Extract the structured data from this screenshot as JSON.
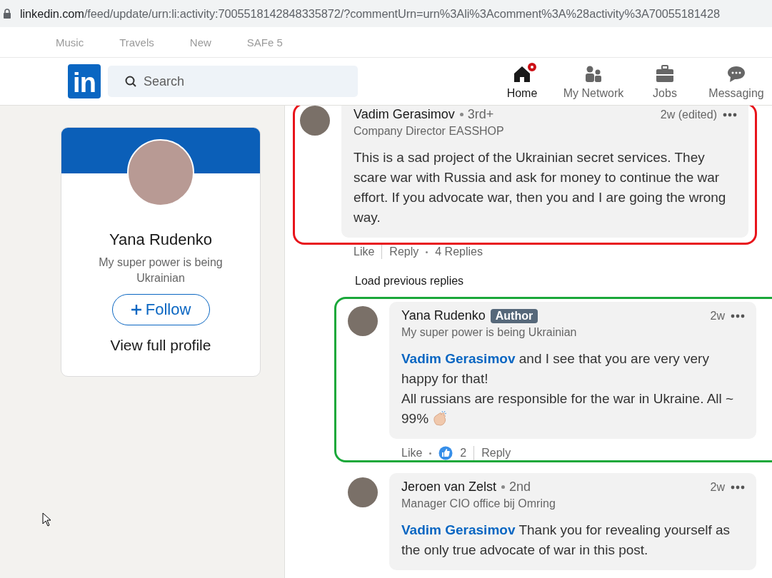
{
  "address_bar": {
    "host": "linkedin.com",
    "path": "/feed/update/urn:li:activity:7005518142848335872/?commentUrn=urn%3Ali%3Acomment%3A%28activity%3A70055181428"
  },
  "bookmarks": [
    "Music",
    "Travels",
    "New",
    "SAFe 5"
  ],
  "header": {
    "logo": "in",
    "search_placeholder": "Search",
    "nav": [
      {
        "kind": "home",
        "label": "Home",
        "selected": true,
        "notification": true
      },
      {
        "kind": "network",
        "label": "My Network",
        "selected": false,
        "notification": false
      },
      {
        "kind": "jobs",
        "label": "Jobs",
        "selected": false,
        "notification": false
      },
      {
        "kind": "messaging",
        "label": "Messaging",
        "selected": false,
        "notification": false
      }
    ]
  },
  "profile_card": {
    "name": "Yana Rudenko",
    "headline": "My super power is being Ukrainian",
    "follow_button": "Follow",
    "view_profile": "View full profile"
  },
  "comment": {
    "name": "Vadim Gerasimov",
    "degree": "3rd+",
    "headline": "Company Director EASSHOP",
    "time": "2w (edited)",
    "body": "This is a sad project of the Ukrainian secret services. They scare war with Russia and ask for money to continue the war effort. If you advocate war, then you and I are going the wrong way.",
    "like": "Like",
    "reply": "Reply",
    "replies_count": "4 Replies",
    "color": "#e8141b",
    "load_previous": "Load previous replies",
    "replies": [
      {
        "name": "Yana Rudenko",
        "badge": "Author",
        "headline": "My super power is being Ukrainian",
        "time": "2w",
        "mention": "Vadim Gerasimov",
        "body": "and I see that you are very very happy for that!\nAll russians are responsible for the war in Ukraine. All ~ 99%",
        "clap": true,
        "like": "Like",
        "like_count": "2",
        "reply": "Reply",
        "color": "#1aa83a"
      },
      {
        "name": "Jeroen van Zelst",
        "degree": "2nd",
        "headline": "Manager CIO office bij Omring",
        "time": "2w",
        "mention": "Vadim Gerasimov",
        "body": "Thank you for revealing yourself as the only true advocate of war in this post."
      }
    ]
  }
}
